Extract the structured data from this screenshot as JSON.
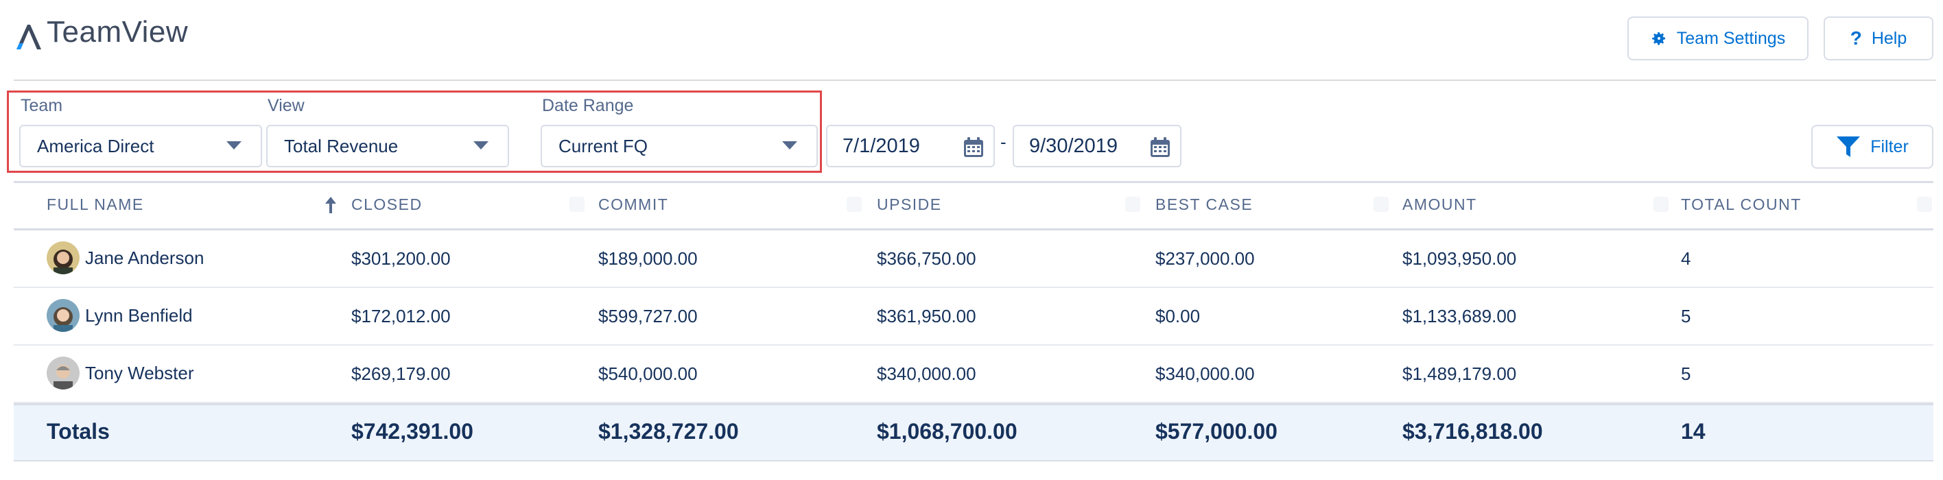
{
  "header": {
    "app_title": "TeamView",
    "team_settings_label": "Team Settings",
    "help_label": "Help"
  },
  "filters": {
    "team": {
      "label": "Team",
      "value": "America Direct"
    },
    "view": {
      "label": "View",
      "value": "Total Revenue"
    },
    "date_range": {
      "label": "Date Range",
      "value": "Current FQ"
    },
    "start_date": "7/1/2019",
    "separator": "-",
    "end_date": "9/30/2019",
    "filter_label": "Filter"
  },
  "table": {
    "columns": [
      "FULL NAME",
      "CLOSED",
      "COMMIT",
      "UPSIDE",
      "BEST CASE",
      "AMOUNT",
      "TOTAL COUNT"
    ],
    "rows": [
      {
        "name": "Jane Anderson",
        "closed": "$301,200.00",
        "commit": "$189,000.00",
        "upside": "$366,750.00",
        "best_case": "$237,000.00",
        "amount": "$1,093,950.00",
        "total_count": "4"
      },
      {
        "name": "Lynn Benfield",
        "closed": "$172,012.00",
        "commit": "$599,727.00",
        "upside": "$361,950.00",
        "best_case": "$0.00",
        "amount": "$1,133,689.00",
        "total_count": "5"
      },
      {
        "name": "Tony Webster",
        "closed": "$269,179.00",
        "commit": "$540,000.00",
        "upside": "$340,000.00",
        "best_case": "$340,000.00",
        "amount": "$1,489,179.00",
        "total_count": "5"
      }
    ],
    "totals": {
      "label": "Totals",
      "closed": "$742,391.00",
      "commit": "$1,328,727.00",
      "upside": "$1,068,700.00",
      "best_case": "$577,000.00",
      "amount": "$3,716,818.00",
      "total_count": "14"
    }
  },
  "colors": {
    "brand_blue": "#0070d2",
    "text_dark": "#16325c",
    "label_gray": "#54698d",
    "highlight_border": "#e0474a",
    "totals_bg": "#eef4fb"
  }
}
